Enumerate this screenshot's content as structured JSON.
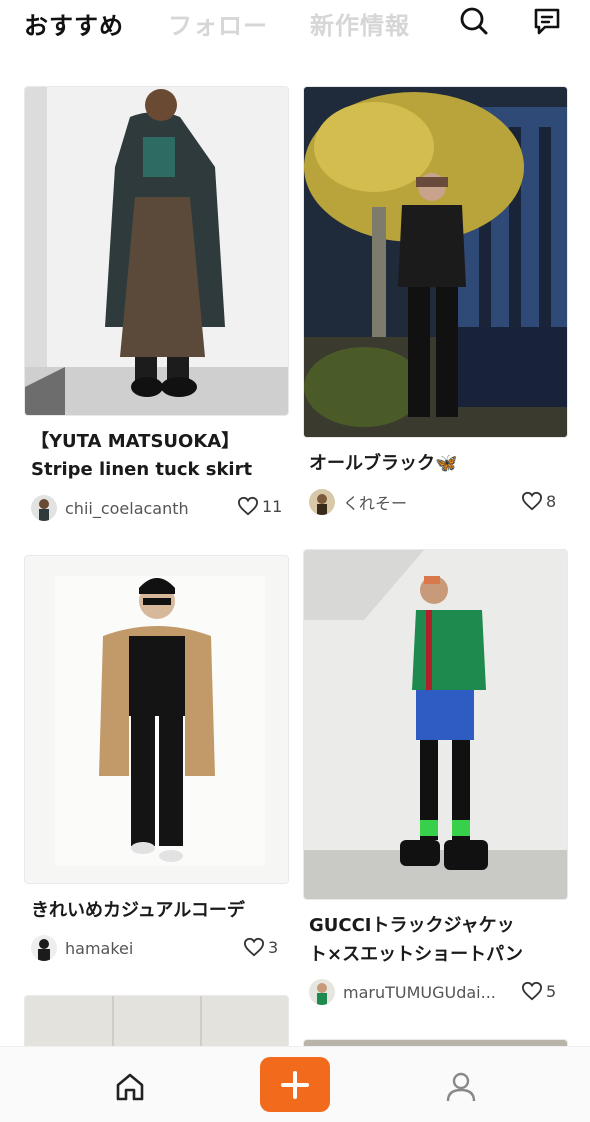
{
  "tabs": [
    {
      "label": "おすすめ",
      "active": true
    },
    {
      "label": "フォロー",
      "active": false
    },
    {
      "label": "新作情報",
      "active": false
    }
  ],
  "header_icons": [
    "search-icon",
    "message-icon"
  ],
  "posts": [
    {
      "title_lines": [
        "【YUTA MATSUOKA】",
        "Stripe linen tuck skirt"
      ],
      "username": "chii_coelacanth",
      "likes": "11"
    },
    {
      "title_lines": [
        "オールブラック🦋"
      ],
      "username": "くれそー",
      "likes": "8"
    },
    {
      "title_lines": [
        "きれいめカジュアルコーデ"
      ],
      "username": "hamakei",
      "likes": "3"
    },
    {
      "title_lines": [
        "GUCCIトラックジャケッ",
        "ト×スエットショートパン"
      ],
      "username": "maruTUMUGUdai...",
      "likes": "5"
    }
  ],
  "bottom_nav": {
    "home_icon": "home-icon",
    "post_icon": "plus-icon",
    "post_color": "#f26b1d",
    "profile_icon": "user-icon"
  }
}
